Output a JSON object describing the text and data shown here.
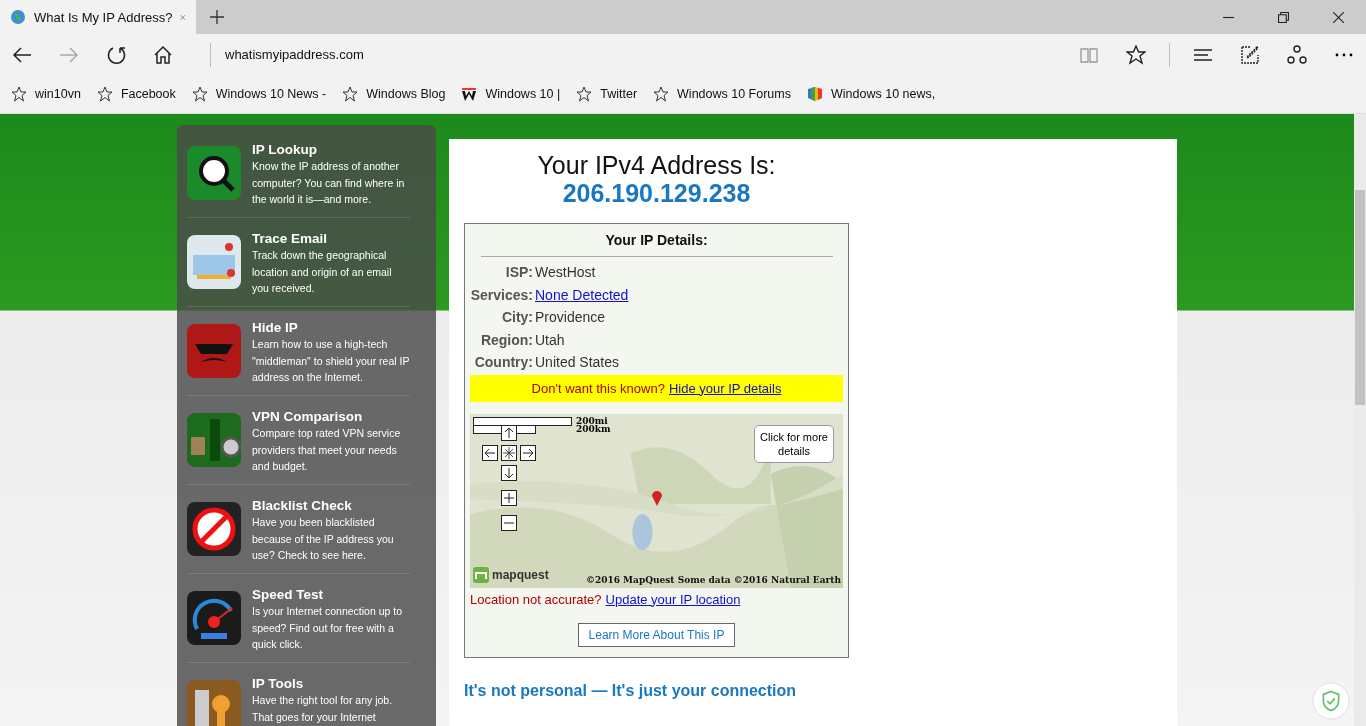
{
  "browser": {
    "tab": {
      "title": "What Is My IP Address?",
      "selected": true
    },
    "address": "whatismyipaddress.com",
    "favorites": [
      {
        "label": "win10vn",
        "kind": "star"
      },
      {
        "label": "Facebook",
        "kind": "star"
      },
      {
        "label": "Windows 10 News -",
        "kind": "star"
      },
      {
        "label": "Windows Blog",
        "kind": "star"
      },
      {
        "label": "Windows 10 |",
        "kind": "w"
      },
      {
        "label": "Twitter",
        "kind": "star"
      },
      {
        "label": "Windows 10 Forums",
        "kind": "star"
      },
      {
        "label": "Windows 10 news,",
        "kind": "cube"
      }
    ]
  },
  "sidebar": {
    "items": [
      {
        "title": "IP Lookup",
        "text": "Know the IP address of another computer? You can find where in the world it is—and more."
      },
      {
        "title": "Trace Email",
        "text": "Track down the geographical location and origin of an email you received."
      },
      {
        "title": "Hide IP",
        "text": "Learn how to use a high-tech \"middleman\" to shield your real IP address on the Internet."
      },
      {
        "title": "VPN Comparison",
        "text": "Compare top rated VPN service providers that meet your needs and budget."
      },
      {
        "title": "Blacklist Check",
        "text": "Have you been blacklisted because of the IP address you use? Check to see here."
      },
      {
        "title": "Speed Test",
        "text": "Is your Internet connection up to speed? Find out for free with a quick click."
      },
      {
        "title": "IP Tools",
        "text": "Have the right tool for any job. That goes for your Internet"
      }
    ]
  },
  "main": {
    "heading": "Your IPv4 Address Is:",
    "ip": "206.190.129.238",
    "details": {
      "title": "Your IP Details:",
      "rows": [
        {
          "label": "ISP:",
          "value": "WestHost",
          "kind": "text"
        },
        {
          "label": "Services:",
          "value": "None Detected",
          "kind": "link"
        },
        {
          "label": "City:",
          "value": "Providence",
          "kind": "text"
        },
        {
          "label": "Region:",
          "value": "Utah",
          "kind": "text"
        },
        {
          "label": "Country:",
          "value": "United States",
          "kind": "text"
        }
      ],
      "notice": {
        "text": "Don't want this known?",
        "link": "Hide your IP details"
      },
      "map": {
        "scale_miles": "200mi",
        "scale_km": "200km",
        "callout": "Click for more details",
        "logo": "mapquest",
        "copyright": "©2016 MapQuest Some data ©2016 Natural Earth"
      },
      "location": {
        "text": "Location not accurate?",
        "link": "Update your IP location"
      },
      "button": "Learn More About This IP"
    },
    "subheading": "It's not personal — It's just your connection"
  }
}
